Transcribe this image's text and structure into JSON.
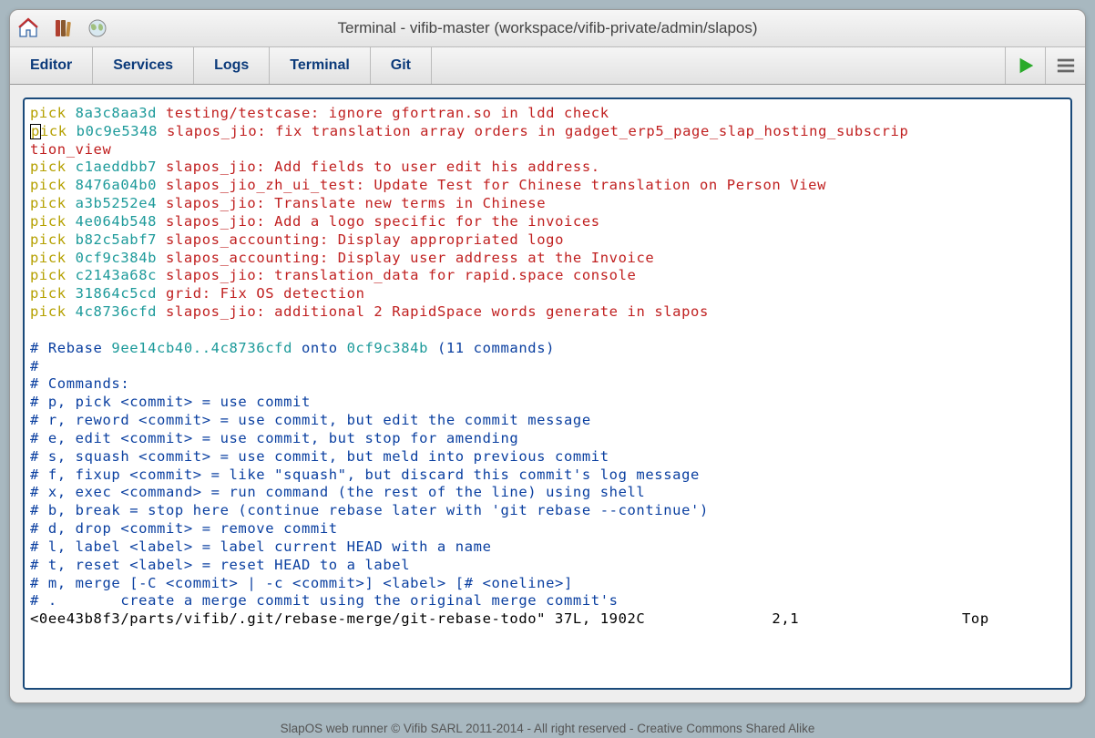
{
  "title": "Terminal - vifib-master (workspace/vifib-private/admin/slapos)",
  "tabs": [
    "Editor",
    "Services",
    "Logs",
    "Terminal",
    "Git"
  ],
  "picks": [
    {
      "cmd": "pick",
      "hash": "8a3c8aa3d",
      "msg": "testing/testcase: ignore gfortran.so in ldd check"
    },
    {
      "cmd": "pick",
      "hash": "b0c9e5348",
      "msg": "slapos_jio: fix translation array orders in gadget_erp5_page_slap_hosting_subscrip",
      "wrap": "tion_view",
      "cursor": true
    },
    {
      "cmd": "pick",
      "hash": "c1aeddbb7",
      "msg": "slapos_jio: Add fields to user edit his address."
    },
    {
      "cmd": "pick",
      "hash": "8476a04b0",
      "msg": "slapos_jio_zh_ui_test: Update Test for Chinese translation on Person View"
    },
    {
      "cmd": "pick",
      "hash": "a3b5252e4",
      "msg": "slapos_jio: Translate new terms in Chinese"
    },
    {
      "cmd": "pick",
      "hash": "4e064b548",
      "msg": "slapos_jio: Add a logo specific for the invoices"
    },
    {
      "cmd": "pick",
      "hash": "b82c5abf7",
      "msg": "slapos_accounting: Display appropriated logo"
    },
    {
      "cmd": "pick",
      "hash": "0cf9c384b",
      "msg": "slapos_accounting: Display user address at the Invoice"
    },
    {
      "cmd": "pick",
      "hash": "c2143a68c",
      "msg": "slapos_jio: translation_data for rapid.space console"
    },
    {
      "cmd": "pick",
      "hash": "31864c5cd",
      "msg": "grid: Fix OS detection"
    },
    {
      "cmd": "pick",
      "hash": "4c8736cfd",
      "msg": "slapos_jio: additional 2 RapidSpace words generate in slapos"
    }
  ],
  "rebase": {
    "prefix": "# Rebase ",
    "range": "9ee14cb40..4c8736cfd",
    "mid": " onto ",
    "onto": "0cf9c384b",
    "count": " (11 commands)"
  },
  "comments": [
    "#",
    "# Commands:",
    "# p, pick <commit> = use commit",
    "# r, reword <commit> = use commit, but edit the commit message",
    "# e, edit <commit> = use commit, but stop for amending",
    "# s, squash <commit> = use commit, but meld into previous commit",
    "# f, fixup <commit> = like \"squash\", but discard this commit's log message",
    "# x, exec <command> = run command (the rest of the line) using shell",
    "# b, break = stop here (continue rebase later with 'git rebase --continue')",
    "# d, drop <commit> = remove commit",
    "# l, label <label> = label current HEAD with a name",
    "# t, reset <label> = reset HEAD to a label",
    "# m, merge [-C <commit> | -c <commit>] <label> [# <oneline>]",
    "# .       create a merge commit using the original merge commit's"
  ],
  "status": {
    "file": "<0ee43b8f3/parts/vifib/.git/rebase-merge/git-rebase-todo\" 37L, 1902C",
    "pos": "2,1",
    "scroll": "Top"
  },
  "footer": "SlapOS web runner © Vifib SARL 2011-2014 - All right reserved - Creative Commons Shared Alike"
}
